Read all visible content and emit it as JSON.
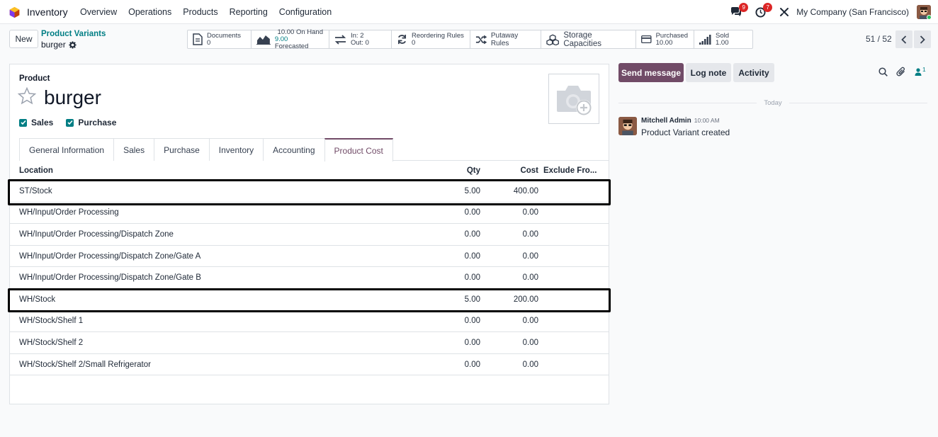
{
  "navbar": {
    "app_name": "Inventory",
    "menu": [
      "Overview",
      "Operations",
      "Products",
      "Reporting",
      "Configuration"
    ],
    "messages_badge": "9",
    "activities_badge": "7",
    "company": "My Company (San Francisco)"
  },
  "control_panel": {
    "new_label": "New",
    "breadcrumb_parent": "Product Variants",
    "breadcrumb_current": "burger",
    "smart_buttons": {
      "documents": {
        "label": "Documents",
        "value": "0"
      },
      "on_hand": {
        "value": "10.00",
        "label": "On Hand",
        "forecast_value": "9.00",
        "forecast_label": "Forecasted"
      },
      "in_out": {
        "in": "In: 2",
        "out": "Out: 0"
      },
      "reordering": {
        "label": "Reordering Rules",
        "value": "0"
      },
      "putaway": {
        "label": "Putaway Rules"
      },
      "storage": {
        "label": "Storage Capacities"
      },
      "purchased": {
        "label": "Purchased",
        "value": "10.00"
      },
      "sold": {
        "label": "Sold",
        "value": "1.00"
      }
    },
    "pager": "51 / 52"
  },
  "form": {
    "product_label": "Product",
    "product_name": "burger",
    "sales_label": "Sales",
    "purchase_label": "Purchase",
    "tabs": [
      "General Information",
      "Sales",
      "Purchase",
      "Inventory",
      "Accounting",
      "Product Cost"
    ],
    "active_tab": "Product Cost",
    "table": {
      "headers": {
        "location": "Location",
        "qty": "Qty",
        "cost": "Cost",
        "exclude": "Exclude Fro..."
      },
      "rows": [
        {
          "location": "ST/Stock",
          "qty": "5.00",
          "cost": "400.00",
          "highlighted": true
        },
        {
          "location": "WH/Input/Order Processing",
          "qty": "0.00",
          "cost": "0.00"
        },
        {
          "location": "WH/Input/Order Processing/Dispatch Zone",
          "qty": "0.00",
          "cost": "0.00"
        },
        {
          "location": "WH/Input/Order Processing/Dispatch Zone/Gate A",
          "qty": "0.00",
          "cost": "0.00"
        },
        {
          "location": "WH/Input/Order Processing/Dispatch Zone/Gate B",
          "qty": "0.00",
          "cost": "0.00"
        },
        {
          "location": "WH/Stock",
          "qty": "5.00",
          "cost": "200.00",
          "highlighted": true
        },
        {
          "location": "WH/Stock/Shelf 1",
          "qty": "0.00",
          "cost": "0.00"
        },
        {
          "location": "WH/Stock/Shelf 2",
          "qty": "0.00",
          "cost": "0.00"
        },
        {
          "location": "WH/Stock/Shelf 2/Small Refrigerator",
          "qty": "0.00",
          "cost": "0.00"
        }
      ]
    }
  },
  "chatter": {
    "send_message": "Send message",
    "log_note": "Log note",
    "activity": "Activity",
    "followers_count": "1",
    "date_separator": "Today",
    "messages": [
      {
        "author": "Mitchell Admin",
        "time": "10:00 AM",
        "body": "Product Variant created"
      }
    ]
  },
  "colors": {
    "brand": "#714b67",
    "link": "#017e84",
    "badge": "#dc2626"
  }
}
